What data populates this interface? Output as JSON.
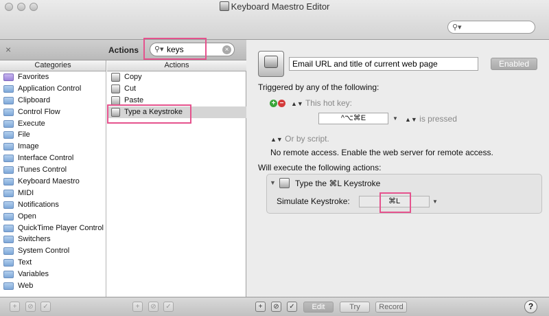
{
  "window": {
    "title": "Keyboard Maestro Editor"
  },
  "toolbar": {
    "search_placeholder": ""
  },
  "left_panel": {
    "actions_title": "Actions",
    "search": {
      "value": "keys",
      "placeholder": ""
    },
    "categories_header": "Categories",
    "actions_header": "Actions",
    "categories": [
      "Favorites",
      "Application Control",
      "Clipboard",
      "Control Flow",
      "Execute",
      "File",
      "Image",
      "Interface Control",
      "iTunes Control",
      "Keyboard Maestro",
      "MIDI",
      "Notifications",
      "Open",
      "QuickTime Player Control",
      "Switchers",
      "System Control",
      "Text",
      "Variables",
      "Web"
    ],
    "actions": [
      "Copy",
      "Cut",
      "Paste",
      "Type a Keystroke"
    ],
    "selected_action": "Type a Keystroke"
  },
  "macro": {
    "name": "Email URL and title of current web page",
    "enabled_label": "Enabled",
    "triggered_label": "Triggered by any of the following:",
    "hotkey_label": "This hot key:",
    "hotkey_value": "^⌥⌘E",
    "pressed_label": "is pressed",
    "or_script": "Or by script.",
    "remote_text": "No remote access.  Enable the web server for remote access.",
    "will_execute": "Will execute the following actions:",
    "action_title": "Type the ⌘L Keystroke",
    "simulate_label": "Simulate Keystroke:",
    "keystroke_value": "⌘L"
  },
  "bottom": {
    "edit": "Edit",
    "try": "Try",
    "record": "Record",
    "help": "?"
  },
  "colors": {
    "highlight": "#e5528d",
    "plus": "#3aa53a",
    "minus": "#d43b3b"
  },
  "icons": {
    "close": "close-icon",
    "search": "search-icon",
    "folder": "folder-icon",
    "keyboard": "keyboard-icon",
    "add": "plus-icon",
    "remove": "minus-icon",
    "disable": "disable-icon",
    "check": "check-icon",
    "help": "help-icon"
  }
}
